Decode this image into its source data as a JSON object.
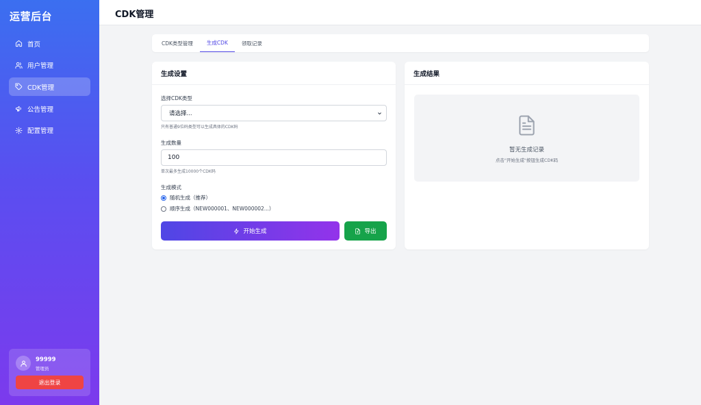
{
  "sidebar": {
    "brand": "运营后台",
    "items": [
      {
        "label": "首页",
        "icon": "home-icon",
        "active": false
      },
      {
        "label": "用户管理",
        "icon": "users-icon",
        "active": false
      },
      {
        "label": "CDK管理",
        "icon": "tag-icon",
        "active": true
      },
      {
        "label": "公告管理",
        "icon": "megaphone-icon",
        "active": false
      },
      {
        "label": "配置管理",
        "icon": "gear-icon",
        "active": false
      }
    ],
    "user": {
      "name": "99999",
      "role": "管理员",
      "logout_label": "退出登录",
      "icon": "user-icon"
    }
  },
  "header": {
    "title": "CDK管理"
  },
  "tabs": [
    {
      "label": "CDK类型管理",
      "active": false
    },
    {
      "label": "生成CDK",
      "active": true
    },
    {
      "label": "领取记录",
      "active": false
    }
  ],
  "settings": {
    "title": "生成设置",
    "type_label": "选择CDK类型",
    "type_value": "请选择...",
    "type_hint": "只有普通9位码类型可以生成具体的CDK码",
    "count_label": "生成数量",
    "count_value": "100",
    "count_hint": "单次最多生成10000个CDK码",
    "mode_label": "生成模式",
    "mode_options": [
      {
        "label": "随机生成（推荐）",
        "checked": true
      },
      {
        "label": "顺序生成（NEW000001、NEW000002...）",
        "checked": false
      }
    ],
    "generate_label": "开始生成",
    "export_label": "导出"
  },
  "results": {
    "title": "生成结果",
    "empty_title": "暂无生成记录",
    "empty_sub": "点击\"开始生成\"按钮生成CDK码",
    "icon": "document-icon"
  },
  "colors": {
    "accent": "#4f46e5",
    "export": "#16a34a",
    "logout": "#ef4444"
  }
}
